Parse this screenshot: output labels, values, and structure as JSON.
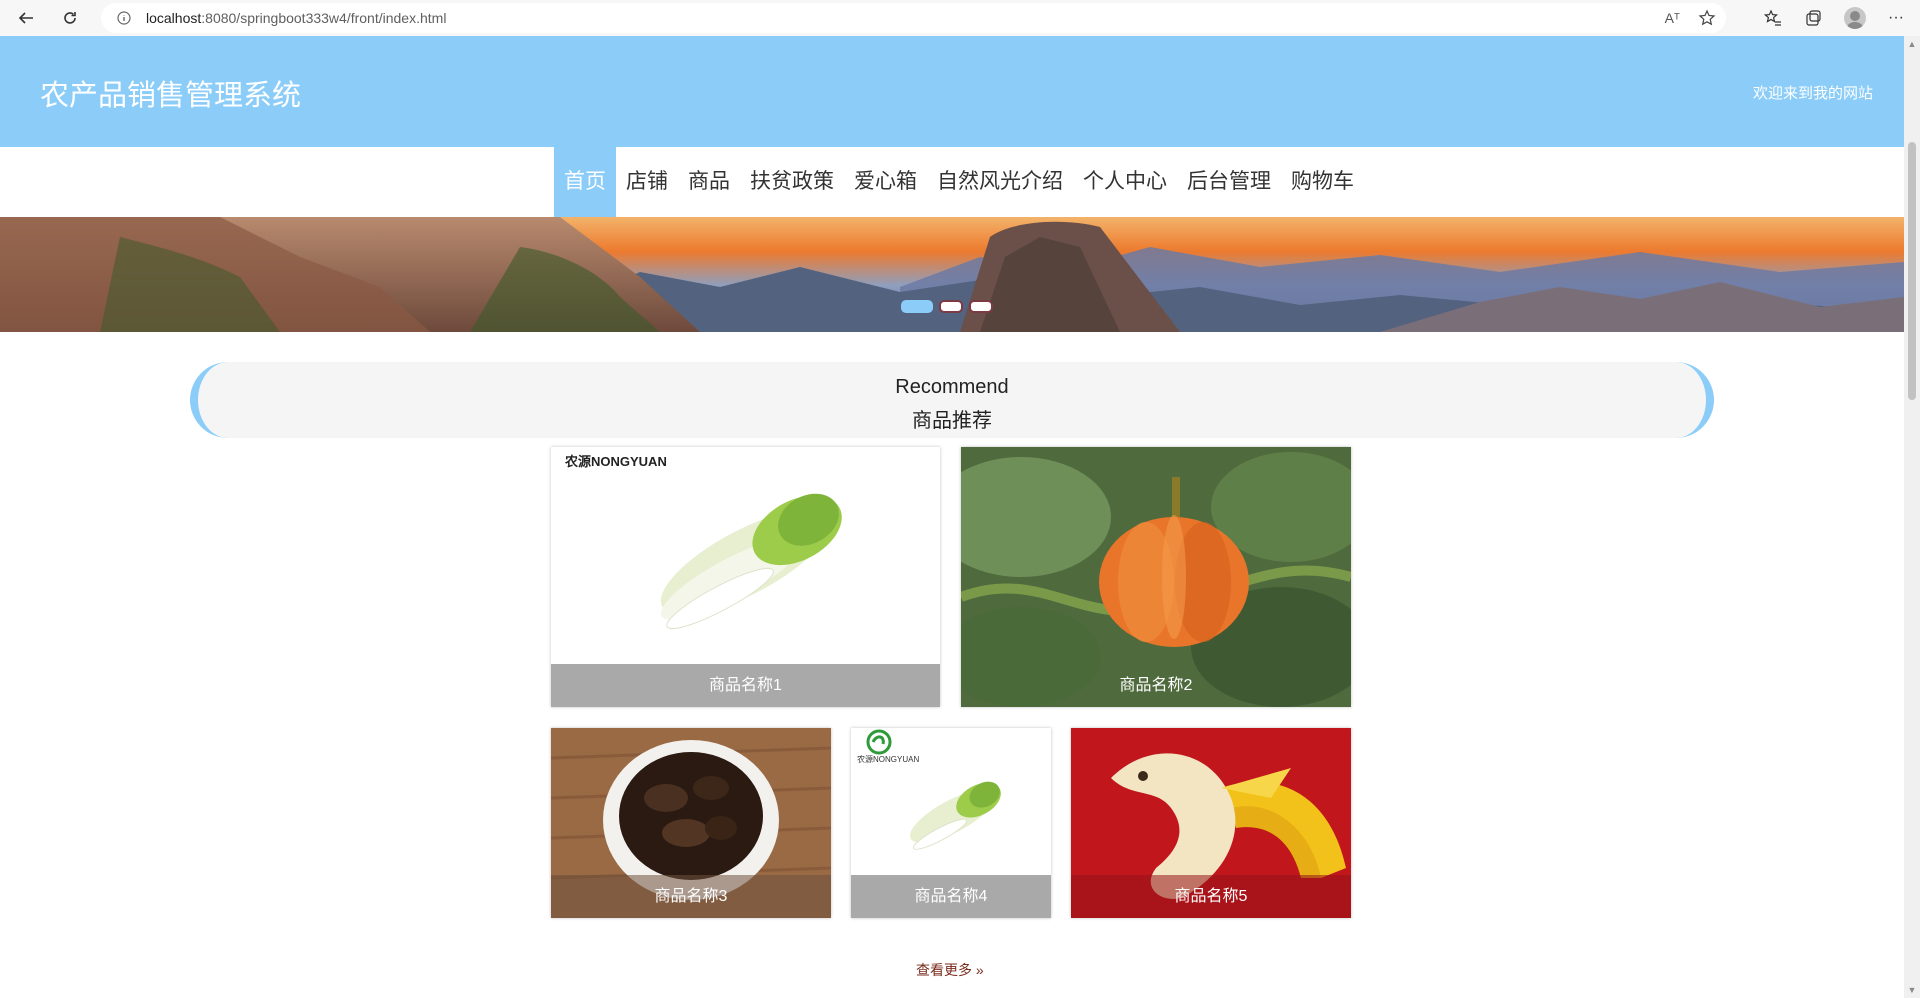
{
  "browser": {
    "url_host": "localhost",
    "url_rest": ":8080/springboot333w4/front/index.html",
    "read_aloud": "Aᴀ"
  },
  "header": {
    "title": "农产品销售管理系统",
    "welcome": "欢迎来到我的网站"
  },
  "nav": {
    "items": [
      "首页",
      "店铺",
      "商品",
      "扶贫政策",
      "爱心箱",
      "自然风光介绍",
      "个人中心",
      "后台管理",
      "购物车"
    ],
    "active_index": 0
  },
  "banner": {
    "slide_count": 3,
    "active_slide": 0
  },
  "recommend": {
    "title_en": "Recommend",
    "title_cn": "商品推荐"
  },
  "products": [
    {
      "name": "商品名称1",
      "brand": "农源NONGYUAN",
      "image": "napa-cabbage"
    },
    {
      "name": "商品名称2",
      "image": "pumpkin"
    },
    {
      "name": "商品名称3",
      "image": "black-fungus"
    },
    {
      "name": "商品名称4",
      "brand": "农源NONGYUAN",
      "image": "napa-cabbage"
    },
    {
      "name": "商品名称5",
      "image": "banana"
    }
  ],
  "more_link": "查看更多 »",
  "colors": {
    "accent": "#8bcdf8",
    "caption_bg": "#a9a9a9",
    "more_link": "#7a2b1d"
  }
}
